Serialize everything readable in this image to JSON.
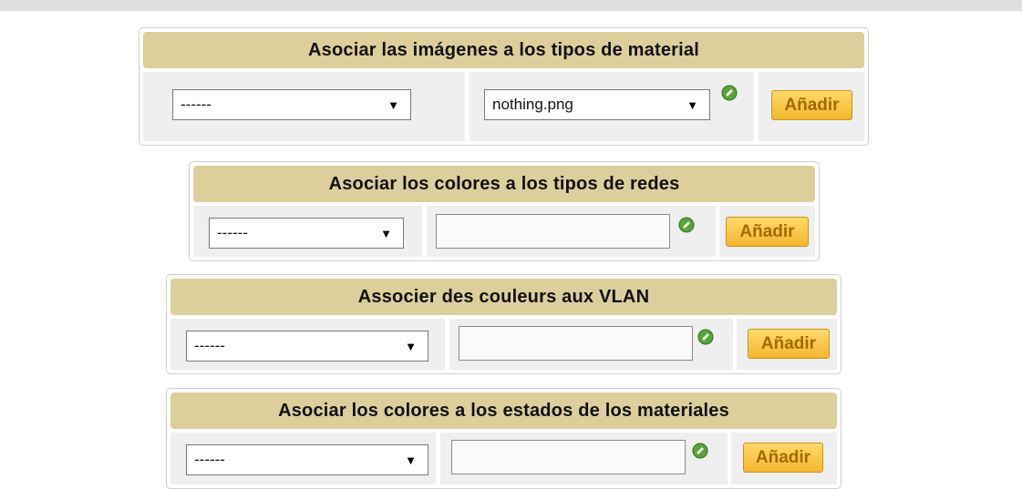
{
  "sections": [
    {
      "title": "Asociar las imágenes a los tipos de material",
      "type_select": "------",
      "value_field": "nothing.png",
      "add_label": "Añadir"
    },
    {
      "title": "Asociar los colores a los tipos de redes",
      "type_select": "------",
      "value_field": "",
      "add_label": "Añadir"
    },
    {
      "title": "Associer des couleurs aux VLAN",
      "type_select": "------",
      "value_field": "",
      "add_label": "Añadir"
    },
    {
      "title": "Asociar los colores a los estados de los materiales",
      "type_select": "------",
      "value_field": "",
      "add_label": "Añadir"
    }
  ],
  "icons": {
    "picker": "color-picker-icon",
    "dropdown": "dropdown-arrow-icon"
  },
  "colors": {
    "header_bg": "#ddcf9b",
    "button_bg": "#f5b731",
    "button_text": "#a36a00",
    "picker_icon": "#5aa33a"
  }
}
